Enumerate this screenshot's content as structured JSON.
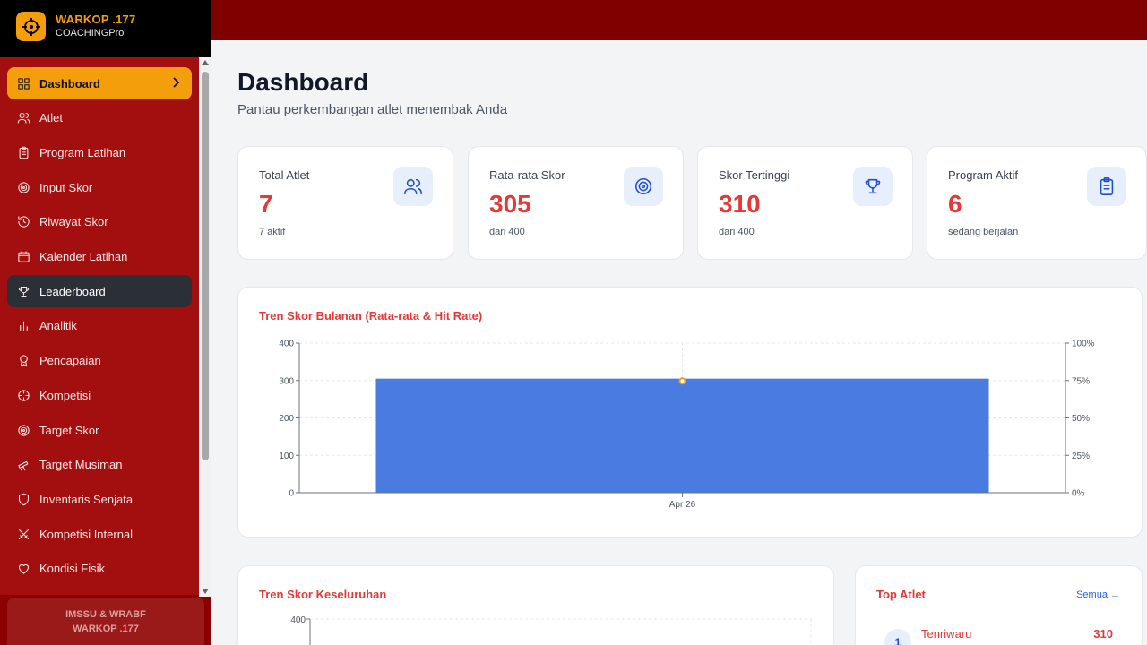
{
  "brand": {
    "title": "WARKOP .177",
    "subtitle": "COACHINGPro"
  },
  "sidebar": {
    "items": [
      {
        "label": "Dashboard",
        "icon": "grid-icon",
        "state": "active"
      },
      {
        "label": "Atlet",
        "icon": "users-icon"
      },
      {
        "label": "Program Latihan",
        "icon": "clipboard-icon"
      },
      {
        "label": "Input Skor",
        "icon": "target-icon"
      },
      {
        "label": "Riwayat Skor",
        "icon": "history-icon"
      },
      {
        "label": "Kalender Latihan",
        "icon": "calendar-icon"
      },
      {
        "label": "Leaderboard",
        "icon": "trophy-icon",
        "state": "hover"
      },
      {
        "label": "Analitik",
        "icon": "bar-chart-icon"
      },
      {
        "label": "Pencapaian",
        "icon": "award-icon"
      },
      {
        "label": "Kompetisi",
        "icon": "crosshair-icon"
      },
      {
        "label": "Target Skor",
        "icon": "target-icon"
      },
      {
        "label": "Target Musiman",
        "icon": "telescope-icon"
      },
      {
        "label": "Inventaris Senjata",
        "icon": "shield-icon"
      },
      {
        "label": "Kompetisi Internal",
        "icon": "swords-icon"
      },
      {
        "label": "Kondisi Fisik",
        "icon": "heart-icon"
      }
    ],
    "footer_line1": "IMSSU & WRABF",
    "footer_line2": "WARKOP .177"
  },
  "header": {
    "title": "Dashboard",
    "subtitle": "Pantau perkembangan atlet menembak Anda"
  },
  "stats": [
    {
      "label": "Total Atlet",
      "value": "7",
      "note": "7 aktif",
      "icon": "users-icon"
    },
    {
      "label": "Rata-rata Skor",
      "value": "305",
      "note": "dari 400",
      "icon": "target-icon"
    },
    {
      "label": "Skor Tertinggi",
      "value": "310",
      "note": "dari 400",
      "icon": "trophy-icon"
    },
    {
      "label": "Program Aktif",
      "value": "6",
      "note": "sedang berjalan",
      "icon": "clipboard-icon"
    }
  ],
  "monthly_chart": {
    "title": "Tren Skor Bulanan (Rata-rata & Hit Rate)"
  },
  "overall_chart": {
    "title": "Tren Skor Keseluruhan",
    "first_tick": "400"
  },
  "top_atlet": {
    "title": "Top Atlet",
    "link": "Semua →",
    "items": [
      {
        "rank": "1",
        "name": "Tenriwaru",
        "score": "310"
      }
    ]
  },
  "colors": {
    "sidebar": "#8b0000",
    "accent": "#f59e0b",
    "value_red": "#e53935",
    "bar_blue": "#4a7bdf"
  },
  "chart_data": [
    {
      "type": "bar",
      "title": "Tren Skor Bulanan (Rata-rata & Hit Rate)",
      "categories": [
        "Apr 26"
      ],
      "series": [
        {
          "values": [
            305
          ],
          "axis": "left",
          "kind": "bar"
        },
        {
          "values": [
            75
          ],
          "axis": "right",
          "kind": "line"
        }
      ],
      "ylim": [
        0,
        400
      ],
      "y_ticks": [
        "0",
        "100",
        "200",
        "300",
        "400"
      ],
      "y2lim": [
        0,
        100
      ],
      "y2_ticks": [
        "0%",
        "25%",
        "50%",
        "75%",
        "100%"
      ],
      "grid": true
    }
  ]
}
